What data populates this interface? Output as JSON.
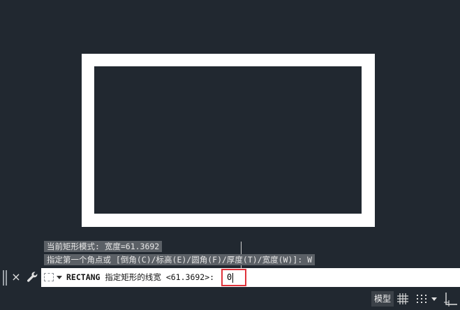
{
  "history": {
    "line1": "当前矩形模式:  宽度=61.3692",
    "line2": "指定第一个角点或 [倒角(C)/标高(E)/圆角(F)/厚度(T)/宽度(W)]: W"
  },
  "command_line": {
    "close_label": "×",
    "command_name": "RECTANG",
    "prompt": "指定矩形的线宽 <61.3692>:",
    "input_value": "0"
  },
  "status_bar": {
    "model_tab_label": "模型"
  },
  "icons": {
    "close": "close-icon",
    "wrench": "wrench-icon",
    "rect_command": "rectangle-icon",
    "grid": "grid-icon",
    "snap": "snap-icon",
    "ortho": "ortho-icon"
  },
  "colors": {
    "background": "#212830",
    "rectangle": "#ffffff",
    "input_border": "#e0323a"
  }
}
